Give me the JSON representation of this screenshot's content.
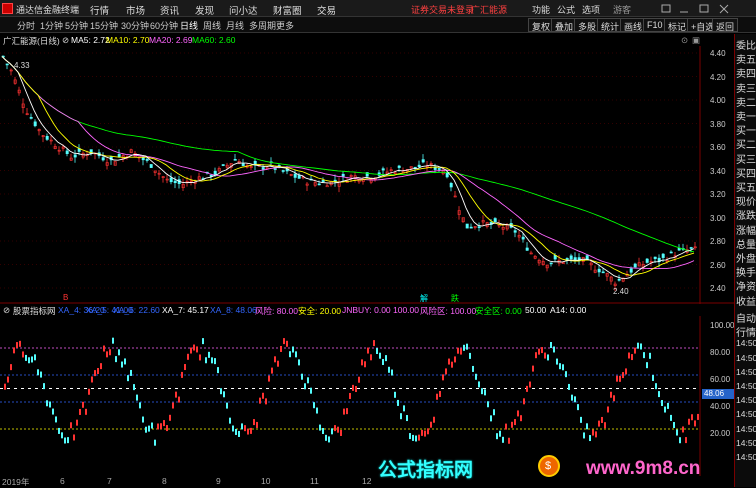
{
  "app": {
    "title": "通达信金融终端",
    "menu": [
      "行情",
      "市场",
      "资讯",
      "发现",
      "问小达",
      "财富圈",
      "交易"
    ],
    "notice": "证券交易未登录",
    "broker": "广汇能源",
    "right_menu": [
      "功能",
      "公式",
      "选项",
      "游客"
    ]
  },
  "toolbar": {
    "periods": [
      "分时",
      "1分钟",
      "5分钟",
      "15分钟",
      "30分钟",
      "60分钟",
      "日线",
      "周线",
      "月线",
      "多周期",
      "更多"
    ],
    "active_period": "日线",
    "buttons": [
      "复权",
      "叠加",
      "多股",
      "统计",
      "画线",
      "F10",
      "标记",
      "+自选",
      "返回"
    ]
  },
  "main_chart": {
    "title": "广汇能源(日线)",
    "ma5": "MA5: 2.72",
    "ma10": "MA10: 2.70",
    "ma20": "MA20: 2.69",
    "ma60": "MA60: 2.60",
    "high_label": "4.33",
    "low_label": "2.40",
    "marker_left": "B",
    "marker_mid1": "解",
    "marker_mid2": "跌",
    "y_ticks": [
      "4.40",
      "4.20",
      "4.00",
      "3.80",
      "3.60",
      "3.40",
      "3.20",
      "3.00",
      "2.80",
      "2.60",
      "2.40"
    ],
    "colors": {
      "ma5": "#ffffff",
      "ma10": "#ffff00",
      "ma20": "#ff66ff",
      "ma60": "#00ff00"
    }
  },
  "indicator": {
    "title": "股票指标网",
    "items": [
      {
        "text": "XA_4: 36.20",
        "color": "#3366ff"
      },
      {
        "text": "XA_5: 41.00",
        "color": "#3366ff"
      },
      {
        "text": "XA_6: 22.60",
        "color": "#3366ff"
      },
      {
        "text": "XA_7: 45.17",
        "color": "#ffffff"
      },
      {
        "text": "XA_8: 48.06",
        "color": "#3366ff"
      },
      {
        "text": "风险: 80.00",
        "color": "#ff66ff"
      },
      {
        "text": "安全: 20.00",
        "color": "#ffff00"
      },
      {
        "text": "JNBUY: 0.00",
        "color": "#ff66ff"
      },
      {
        "text": "100.00",
        "color": "#ff66ff"
      },
      {
        "text": "风险区: 100.00",
        "color": "#ff66ff"
      },
      {
        "text": "安全区: 0.00",
        "color": "#00ff00"
      },
      {
        "text": "50.00",
        "color": "#ffffff"
      },
      {
        "text": "A14: 0.00",
        "color": "#ffffff"
      }
    ],
    "y_ticks": [
      "100.00",
      "80.00",
      "60.00",
      "40.00",
      "20.00"
    ],
    "current_value": "48.06"
  },
  "dates": [
    "2019年",
    "6",
    "7",
    "8",
    "9",
    "10",
    "11",
    "12"
  ],
  "right_panel": {
    "items": [
      "委比",
      "卖五",
      "卖四",
      "卖三",
      "卖二",
      "卖一",
      "买一",
      "买二",
      "买三",
      "买四",
      "买五",
      "现价",
      "涨跌",
      "涨幅",
      "总量",
      "外盘",
      "换手",
      "净资",
      "收益"
    ],
    "lower_items": [
      "自动",
      "行情",
      "14:50",
      "14:50",
      "14:50",
      "14:50",
      "14:50",
      "14:50",
      "14:50",
      "14:50",
      "14:50"
    ]
  },
  "watermark": {
    "left": "公式指标网",
    "logo": "$",
    "right": "www.9m8.cn"
  }
}
